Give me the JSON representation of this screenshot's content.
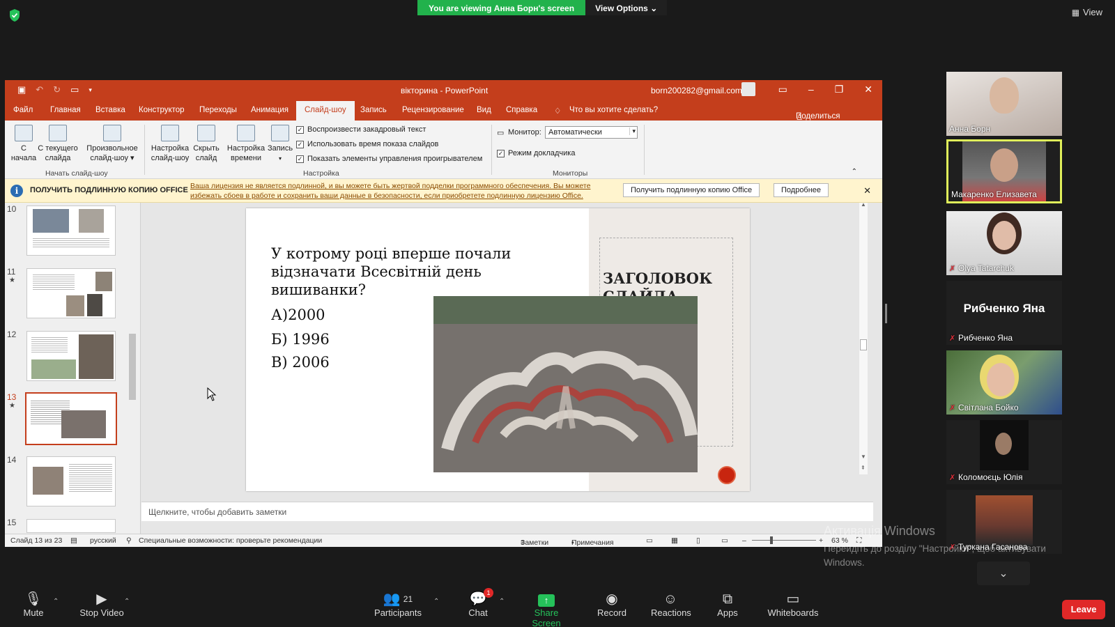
{
  "zoom": {
    "banner": "You are viewing Анна Борн's screen",
    "view_options": "View Options",
    "view_label": "View",
    "toolbar": {
      "mute": "Mute",
      "stop_video": "Stop Video",
      "participants": "Participants",
      "participants_count": "21",
      "chat": "Chat",
      "chat_badge": "1",
      "share_screen": "Share Screen",
      "record": "Record",
      "reactions": "Reactions",
      "apps": "Apps",
      "whiteboards": "Whiteboards",
      "leave": "Leave"
    },
    "participants": [
      {
        "name": "Анна Борн",
        "muted": false
      },
      {
        "name": "Макаренко Елизавета",
        "muted": false,
        "speaking": true
      },
      {
        "name": "Olya Tatarchuk",
        "muted": true
      },
      {
        "name": "Рибченко Яна",
        "muted": true,
        "display": "Рибченко Яна"
      },
      {
        "name": "Світлана Бойко",
        "muted": true
      },
      {
        "name": "Коломоєць Юлія",
        "muted": true
      },
      {
        "name": "Туркана Гасанова",
        "muted": true
      }
    ],
    "watermark": {
      "title": "Активація Windows",
      "text": "Перейдіть до розділу \"Настройки\", щоб активувати Windows."
    }
  },
  "ppt": {
    "title": "вікторина  -  PowerPoint",
    "account": "born200282@gmail.com",
    "tabs": [
      "Файл",
      "Главная",
      "Вставка",
      "Конструктор",
      "Переходы",
      "Анимация",
      "Слайд-шоу",
      "Запись",
      "Рецензирование",
      "Вид",
      "Справка",
      "Что вы хотите сделать?"
    ],
    "active_tab": "Слайд-шоу",
    "share": "Поделиться",
    "ribbon": {
      "from_start": "С\nначала",
      "from_current": "С текущего\nслайда",
      "custom_show": "Произвольное\nслайд-шоу",
      "group_start": "Начать слайд-шоу",
      "setup_show": "Настройка\nслайд-шоу",
      "hide_slide": "Скрыть\nслайд",
      "rehearse": "Настройка\nвремени",
      "record": "Запись",
      "check_narration": "Воспроизвести закадровый текст",
      "check_timings": "Использовать время показа слайдов",
      "check_media": "Показать элементы управления проигрывателем",
      "group_setup": "Настройка",
      "monitor_label": "Монитор:",
      "monitor_value": "Автоматически",
      "presenter_view": "Режим докладчика",
      "group_monitors": "Мониторы"
    },
    "message_bar": {
      "heading": "ПОЛУЧИТЬ ПОДЛИННУЮ КОПИЮ OFFICE",
      "text": "Ваша лицензия не является подлинной, и вы можете быть жертвой подделки программного обеспечения. Вы можете избежать сбоев в работе и сохранить ваши данные в безопасности, если приобретете подлинную лицензию Office.",
      "btn_get": "Получить подлинную копию Office",
      "btn_more": "Подробнее"
    },
    "thumbnails": [
      {
        "num": "10",
        "star": false
      },
      {
        "num": "11",
        "star": true
      },
      {
        "num": "12",
        "star": false
      },
      {
        "num": "13",
        "star": true,
        "selected": true
      },
      {
        "num": "14",
        "star": false
      },
      {
        "num": "15",
        "star": false
      }
    ],
    "slide": {
      "question": "У котрому році вперше почали відзначати Всесвітній день вишиванки?",
      "answer_a": "А)2000",
      "answer_b": "Б) 1996",
      "answer_c": "В) 2006",
      "title_placeholder": "ЗАГОЛОВОК",
      "title_placeholder_2": "СЛАЙДА"
    },
    "notes_placeholder": "Щелкните, чтобы добавить заметки",
    "status": {
      "slide_of": "Слайд 13 из 23",
      "language": "русский",
      "accessibility": "Специальные возможности: проверьте рекомендации",
      "notes": "Заметки",
      "comments": "Примечания",
      "zoom": "63 %"
    }
  }
}
